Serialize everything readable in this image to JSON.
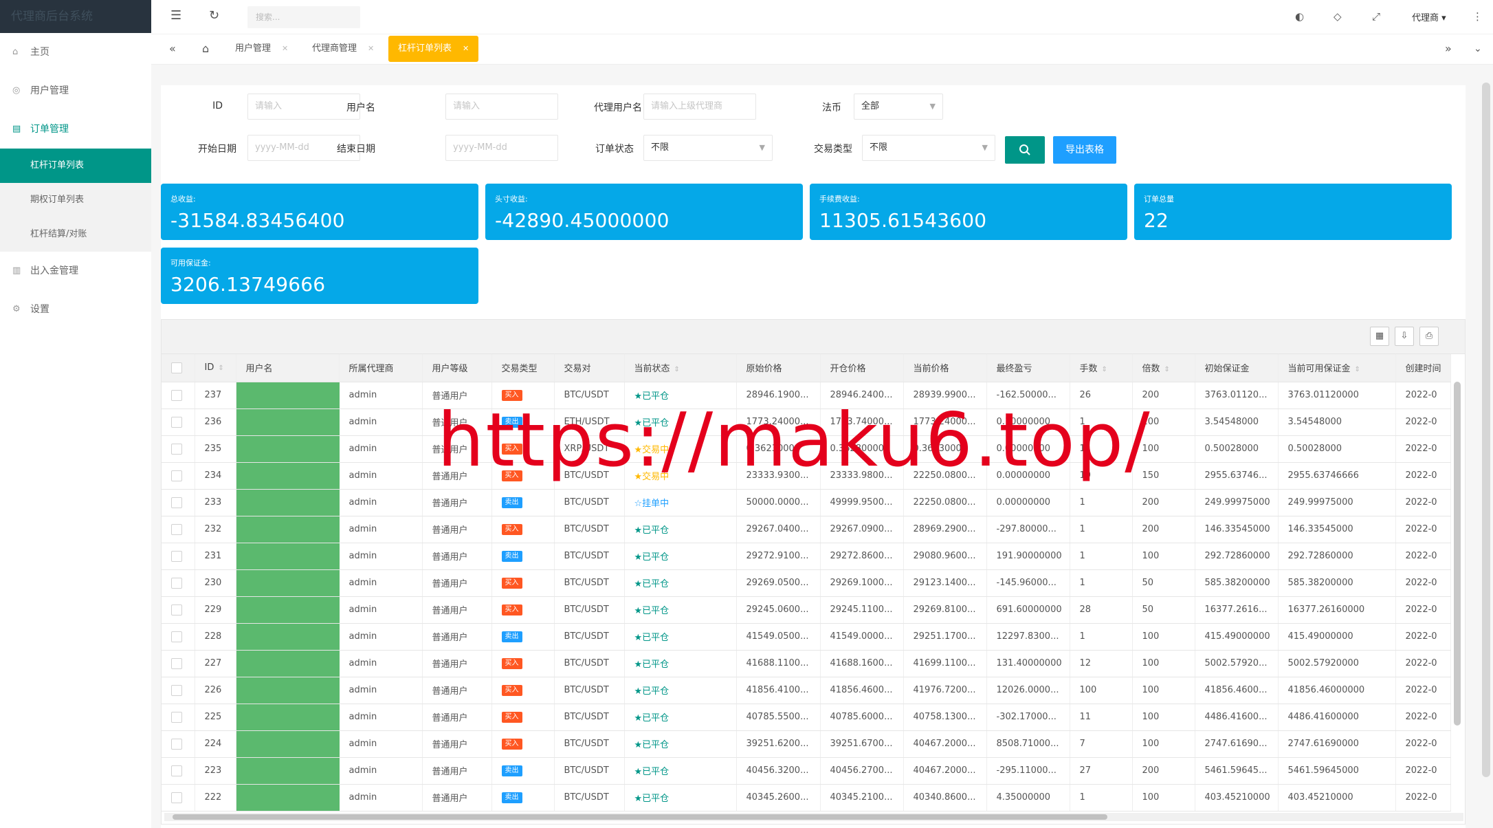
{
  "sidebar": {
    "logo": "代理商后台系统",
    "items": [
      {
        "label": "主页"
      },
      {
        "label": "用户管理"
      },
      {
        "label": "订单管理"
      },
      {
        "label": "出入金管理"
      },
      {
        "label": "设置"
      }
    ],
    "subitems": [
      {
        "label": "杠杆订单列表"
      },
      {
        "label": "期权订单列表"
      },
      {
        "label": "杠杆结算/对账"
      }
    ]
  },
  "topbar": {
    "search_placeholder": "搜索...",
    "agent_label": "代理商"
  },
  "tabs": [
    {
      "label": "用户管理"
    },
    {
      "label": "代理商管理"
    },
    {
      "label": "杠杆订单列表"
    }
  ],
  "filters": {
    "id_label": "ID",
    "id_placeholder": "请输入",
    "username_label": "用户名",
    "username_placeholder": "请输入",
    "agent_label": "代理用户名",
    "agent_placeholder": "请输入上级代理商",
    "currency_label": "法币",
    "currency_value": "全部",
    "start_label": "开始日期",
    "start_placeholder": "yyyy-MM-dd",
    "end_label": "结束日期",
    "end_placeholder": "yyyy-MM-dd",
    "status_label": "订单状态",
    "status_value": "不限",
    "type_label": "交易类型",
    "type_value": "不限",
    "export_label": "导出表格"
  },
  "stats": [
    {
      "label": "总收益:",
      "value": "-31584.83456400"
    },
    {
      "label": "头寸收益:",
      "value": "-42890.45000000"
    },
    {
      "label": "手续费收益:",
      "value": "11305.61543600"
    },
    {
      "label": "订单总量",
      "value": "22"
    },
    {
      "label": "可用保证金:",
      "value": "3206.13749666"
    }
  ],
  "table": {
    "columns": [
      "ID",
      "用户名",
      "所属代理商",
      "用户等级",
      "交易类型",
      "交易对",
      "当前状态",
      "原始价格",
      "开仓价格",
      "当前价格",
      "最终盈亏",
      "手数",
      "倍数",
      "初始保证金",
      "当前可用保证金",
      "创建时间"
    ],
    "rows": [
      {
        "id": "237",
        "agent": "admin",
        "level": "普通用户",
        "type": "买入",
        "pair": "BTC/USDT",
        "status": "★已平仓",
        "orig": "28946.1900...",
        "open": "28946.2400...",
        "cur": "28939.9900...",
        "pnl": "-162.50000...",
        "lots": "26",
        "mult": "200",
        "init": "3763.01120...",
        "avail": "3763.01120000",
        "created": "2022-0"
      },
      {
        "id": "236",
        "agent": "admin",
        "level": "普通用户",
        "type": "卖出",
        "pair": "ETH/USDT",
        "status": "★已平仓",
        "orig": "1773.24000...",
        "open": "1773.74000...",
        "cur": "1773.24000...",
        "pnl": "0.10000000",
        "lots": "1",
        "mult": "100",
        "init": "3.54548000",
        "avail": "3.54548000",
        "created": "2022-0"
      },
      {
        "id": "235",
        "agent": "admin",
        "level": "普通用户",
        "type": "买入",
        "pair": "XRP/USDT",
        "status": "★交易中",
        "orig": "0.36230000",
        "open": "0.36280000",
        "cur": "0.36230000",
        "pnl": "0.00000000",
        "lots": "1",
        "mult": "100",
        "init": "0.50028000",
        "avail": "0.50028000",
        "created": "2022-0"
      },
      {
        "id": "234",
        "agent": "admin",
        "level": "普通用户",
        "type": "买入",
        "pair": "BTC/USDT",
        "status": "★交易中",
        "orig": "23333.9300...",
        "open": "23333.9800...",
        "cur": "22250.0800...",
        "pnl": "0.00000000",
        "lots": "19",
        "mult": "150",
        "init": "2955.63746...",
        "avail": "2955.63746666",
        "created": "2022-0"
      },
      {
        "id": "233",
        "agent": "admin",
        "level": "普通用户",
        "type": "卖出",
        "pair": "BTC/USDT",
        "status": "☆挂单中",
        "orig": "50000.0000...",
        "open": "49999.9500...",
        "cur": "22250.0800...",
        "pnl": "0.00000000",
        "lots": "1",
        "mult": "200",
        "init": "249.99975000",
        "avail": "249.99975000",
        "created": "2022-0"
      },
      {
        "id": "232",
        "agent": "admin",
        "level": "普通用户",
        "type": "买入",
        "pair": "BTC/USDT",
        "status": "★已平仓",
        "orig": "29267.0400...",
        "open": "29267.0900...",
        "cur": "28969.2900...",
        "pnl": "-297.80000...",
        "lots": "1",
        "mult": "200",
        "init": "146.33545000",
        "avail": "146.33545000",
        "created": "2022-0"
      },
      {
        "id": "231",
        "agent": "admin",
        "level": "普通用户",
        "type": "卖出",
        "pair": "BTC/USDT",
        "status": "★已平仓",
        "orig": "29272.9100...",
        "open": "29272.8600...",
        "cur": "29080.9600...",
        "pnl": "191.90000000",
        "lots": "1",
        "mult": "100",
        "init": "292.72860000",
        "avail": "292.72860000",
        "created": "2022-0"
      },
      {
        "id": "230",
        "agent": "admin",
        "level": "普通用户",
        "type": "买入",
        "pair": "BTC/USDT",
        "status": "★已平仓",
        "orig": "29269.0500...",
        "open": "29269.1000...",
        "cur": "29123.1400...",
        "pnl": "-145.96000...",
        "lots": "1",
        "mult": "50",
        "init": "585.38200000",
        "avail": "585.38200000",
        "created": "2022-0"
      },
      {
        "id": "229",
        "agent": "admin",
        "level": "普通用户",
        "type": "买入",
        "pair": "BTC/USDT",
        "status": "★已平仓",
        "orig": "29245.0600...",
        "open": "29245.1100...",
        "cur": "29269.8100...",
        "pnl": "691.60000000",
        "lots": "28",
        "mult": "50",
        "init": "16377.2616...",
        "avail": "16377.26160000",
        "created": "2022-0"
      },
      {
        "id": "228",
        "agent": "admin",
        "level": "普通用户",
        "type": "卖出",
        "pair": "BTC/USDT",
        "status": "★已平仓",
        "orig": "41549.0500...",
        "open": "41549.0000...",
        "cur": "29251.1700...",
        "pnl": "12297.8300...",
        "lots": "1",
        "mult": "100",
        "init": "415.49000000",
        "avail": "415.49000000",
        "created": "2022-0"
      },
      {
        "id": "227",
        "agent": "admin",
        "level": "普通用户",
        "type": "买入",
        "pair": "BTC/USDT",
        "status": "★已平仓",
        "orig": "41688.1100...",
        "open": "41688.1600...",
        "cur": "41699.1100...",
        "pnl": "131.40000000",
        "lots": "12",
        "mult": "100",
        "init": "5002.57920...",
        "avail": "5002.57920000",
        "created": "2022-0"
      },
      {
        "id": "226",
        "agent": "admin",
        "level": "普通用户",
        "type": "买入",
        "pair": "BTC/USDT",
        "status": "★已平仓",
        "orig": "41856.4100...",
        "open": "41856.4600...",
        "cur": "41976.7200...",
        "pnl": "12026.0000...",
        "lots": "100",
        "mult": "100",
        "init": "41856.4600...",
        "avail": "41856.46000000",
        "created": "2022-0"
      },
      {
        "id": "225",
        "agent": "admin",
        "level": "普通用户",
        "type": "买入",
        "pair": "BTC/USDT",
        "status": "★已平仓",
        "orig": "40785.5500...",
        "open": "40785.6000...",
        "cur": "40758.1300...",
        "pnl": "-302.17000...",
        "lots": "11",
        "mult": "100",
        "init": "4486.41600...",
        "avail": "4486.41600000",
        "created": "2022-0"
      },
      {
        "id": "224",
        "agent": "admin",
        "level": "普通用户",
        "type": "买入",
        "pair": "BTC/USDT",
        "status": "★已平仓",
        "orig": "39251.6200...",
        "open": "39251.6700...",
        "cur": "40467.2000...",
        "pnl": "8508.71000...",
        "lots": "7",
        "mult": "100",
        "init": "2747.61690...",
        "avail": "2747.61690000",
        "created": "2022-0"
      },
      {
        "id": "223",
        "agent": "admin",
        "level": "普通用户",
        "type": "卖出",
        "pair": "BTC/USDT",
        "status": "★已平仓",
        "orig": "40456.3200...",
        "open": "40456.2700...",
        "cur": "40467.2000...",
        "pnl": "-295.11000...",
        "lots": "27",
        "mult": "200",
        "init": "5461.59645...",
        "avail": "5461.59645000",
        "created": "2022-0"
      },
      {
        "id": "222",
        "agent": "admin",
        "level": "普通用户",
        "type": "卖出",
        "pair": "BTC/USDT",
        "status": "★已平仓",
        "orig": "40345.2600...",
        "open": "40345.2100...",
        "cur": "40340.8600...",
        "pnl": "4.35000000",
        "lots": "1",
        "mult": "100",
        "init": "403.45210000",
        "avail": "403.45210000",
        "created": "2022-0"
      }
    ]
  },
  "watermark": "https://maku6.top/",
  "colors": {
    "primary": "#009688",
    "blue": "#1E9FFF",
    "stat_blue": "#05A8E8",
    "orange": "#FFB800",
    "buy": "#FF5722",
    "username_mask": "#5BB96E",
    "watermark": "#E4001C"
  }
}
